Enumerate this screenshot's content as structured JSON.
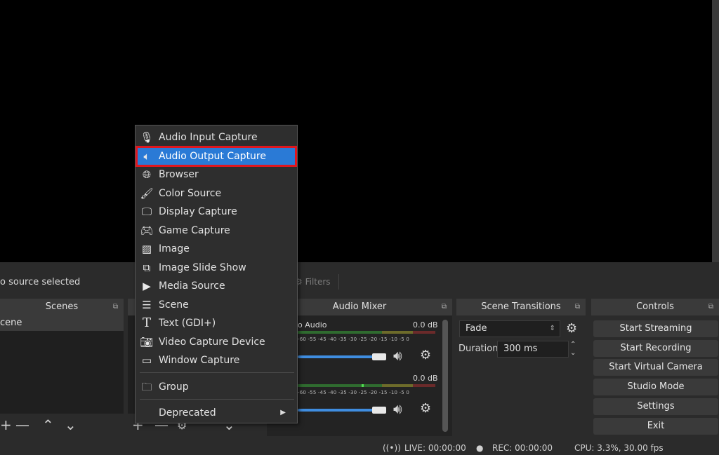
{
  "preview": {},
  "source_bar": {
    "no_source": "o source selected",
    "filters": "Filters"
  },
  "docks": {
    "scenes": {
      "title": "Scenes",
      "items": [
        "cene"
      ]
    },
    "audio_mixer": {
      "title": "Audio Mixer",
      "channels": [
        {
          "name": "o Audio",
          "db": "0.0 dB"
        },
        {
          "name": "",
          "db": "0.0 dB"
        }
      ],
      "ticks": "-60 -55 -45 -40 -35 -30 -25 -20 -15 -10 -5 0"
    },
    "scene_transitions": {
      "title": "Scene Transitions",
      "transition": "Fade",
      "duration_label": "Duration",
      "duration_value": "300 ms"
    },
    "controls": {
      "title": "Controls",
      "buttons": [
        "Start Streaming",
        "Start Recording",
        "Start Virtual Camera",
        "Studio Mode",
        "Settings",
        "Exit"
      ]
    }
  },
  "context_menu": {
    "items": [
      {
        "label": "Audio Input Capture",
        "icon": "microphone-icon"
      },
      {
        "label": "Audio Output Capture",
        "icon": "speaker-icon",
        "selected": true
      },
      {
        "label": "Browser",
        "icon": "globe-icon"
      },
      {
        "label": "Color Source",
        "icon": "brush-icon"
      },
      {
        "label": "Display Capture",
        "icon": "monitor-icon"
      },
      {
        "label": "Game Capture",
        "icon": "gamepad-icon"
      },
      {
        "label": "Image",
        "icon": "image-icon"
      },
      {
        "label": "Image Slide Show",
        "icon": "slideshow-icon"
      },
      {
        "label": "Media Source",
        "icon": "play-icon"
      },
      {
        "label": "Scene",
        "icon": "list-icon"
      },
      {
        "label": "Text (GDI+)",
        "icon": "text-icon"
      },
      {
        "label": "Video Capture Device",
        "icon": "camera-icon"
      },
      {
        "label": "Window Capture",
        "icon": "window-icon"
      },
      {
        "label": "Group",
        "icon": "folder-icon"
      },
      {
        "label": "Deprecated",
        "icon": "",
        "submenu": true
      }
    ],
    "highlight_color": "#e0161e",
    "selection_color": "#2a7ad6"
  },
  "status": {
    "live": "LIVE: 00:00:00",
    "rec": "REC: 00:00:00",
    "cpu": "CPU: 3.3%, 30.00 fps"
  }
}
